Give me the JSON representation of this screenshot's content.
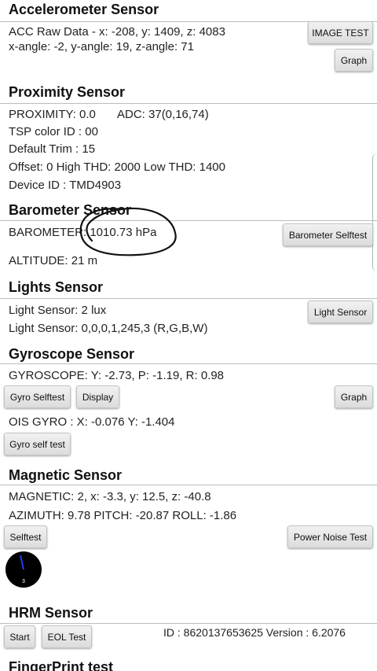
{
  "accelerometer": {
    "title": "Accelerometer Sensor",
    "raw": "ACC Raw Data - x: -208, y: 1409, z: 4083",
    "angle": "x-angle: -2, y-angle: 19, z-angle: 71",
    "image_test_label": "IMAGE TEST",
    "graph_label": "Graph"
  },
  "proximity": {
    "title": "Proximity Sensor",
    "reading": "PROXIMITY: 0.0",
    "adc": "ADC: 37(0,16,74)",
    "tsp": "TSP color ID : 00",
    "trim": "Default Trim : 15",
    "thresholds": "Offset: 0   High THD: 2000   Low THD: 1400",
    "device": "Device ID : TMD4903"
  },
  "barometer": {
    "title": "Barometer Sensor",
    "reading": "BAROMETER: 1010.73 hPa",
    "altitude": "ALTITUDE: 21 m",
    "selftest_label": "Barometer Selftest"
  },
  "lights": {
    "title": "Lights Sensor",
    "lux": "Light Sensor: 2 lux",
    "rgbw": "Light Sensor: 0,0,0,1,245,3 (R,G,B,W)",
    "button_label": "Light Sensor"
  },
  "gyroscope": {
    "title": "Gyroscope Sensor",
    "reading": "GYROSCOPE: Y: -2.73, P: -1.19, R: 0.98",
    "selftest_label": "Gyro Selftest",
    "display_label": "Display",
    "graph_label": "Graph",
    "ois": "OIS GYRO : X: -0.076 Y: -1.404",
    "ois_selftest_label": "Gyro self test"
  },
  "magnetic": {
    "title": "Magnetic Sensor",
    "reading": "MAGNETIC: 2, x: -3.3, y: 12.5, z: -40.8",
    "orientation": "AZIMUTH: 9.78   PITCH: -20.87   ROLL: -1.86",
    "selftest_label": "Selftest",
    "power_noise_label": "Power Noise Test",
    "compass_value": "3"
  },
  "hrm": {
    "title": "HRM Sensor",
    "start_label": "Start",
    "eol_label": "EOL Test",
    "id_text": "ID : 8620137653625   Version : 6.2076"
  },
  "fingerprint": {
    "title": "FingerPrint test"
  },
  "colors": {
    "accent_needle": "#1f3cff",
    "ink": "#111111"
  }
}
